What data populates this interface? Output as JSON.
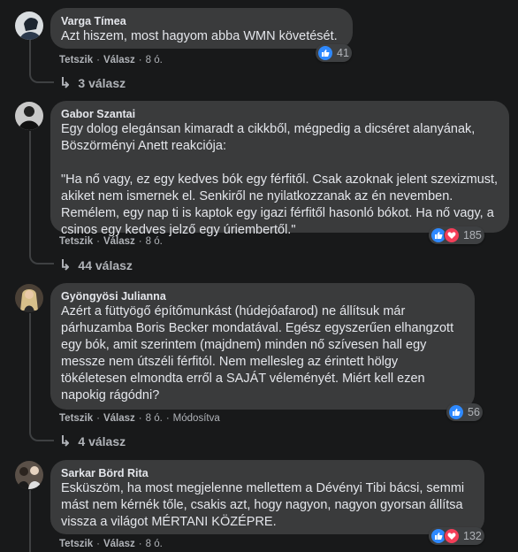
{
  "comments": [
    {
      "author": "Varga Tímea",
      "text": "Azt hiszem, most hagyom abba WMN követését.",
      "reaction_count": "41",
      "reactions": [
        "like-icon"
      ],
      "actions": {
        "like": "Tetszik",
        "reply": "Válasz",
        "time": "8 ó."
      },
      "replies": "3 válasz"
    },
    {
      "author": "Gabor Szantai",
      "text": "Egy dolog elegánsan kimaradt a cikkből, mégpedig a dicséret alanyának, Böszörményi Anett reakciója:\n\n\"Ha nő vagy, ez egy kedves bók egy férfitől. Csak azoknak jelent szexizmust, akiket nem ismernek el. Senkiről ne nyilatkozzanak az én nevemben. Remélem, egy nap ti is kaptok egy igazi férfitől hasonló bókot. Ha nő vagy, a csinos egy kedves jelző egy úriembertől.\"",
      "reaction_count": "185",
      "reactions": [
        "like-icon",
        "heart-icon"
      ],
      "actions": {
        "like": "Tetszik",
        "reply": "Válasz",
        "time": "8 ó."
      },
      "replies": "44 válasz"
    },
    {
      "author": "Gyöngyösi Julianna",
      "text": "Azért a füttyögő építőmunkást (húdejóafarod) ne állítsuk már párhuzamba Boris Becker mondatával. Egész egyszerűen elhangzott egy bók, amit szerintem (majdnem) minden nő szívesen hall egy messze nem útszéli férfitól. Nem mellesleg az érintett hölgy tökéletesen elmondta erről a SAJÁT véleményét. Miért kell ezen napokig rágódni?",
      "reaction_count": "56",
      "reactions": [
        "like-icon"
      ],
      "actions": {
        "like": "Tetszik",
        "reply": "Válasz",
        "time": "8 ó.",
        "edited": "Módosítva"
      },
      "replies": "4 válasz"
    },
    {
      "author": "Sarkar Börd Rita",
      "text": "Esküszöm, ha most megjelenne mellettem a Dévényi Tibi bácsi, semmi mást nem kérnék tőle, csakis azt, hogy nagyon, nagyon gyorsan állítsa vissza a világot MÉRTANI KÖZÉPRE.",
      "reaction_count": "132",
      "reactions": [
        "like-icon",
        "heart-icon"
      ],
      "actions": {
        "like": "Tetszik",
        "reply": "Válasz",
        "time": "8 ó."
      }
    }
  ],
  "colors": {
    "background": "#18191a",
    "bubble": "#3a3b3c",
    "like": "#2e89ff",
    "heart": "#f33e58",
    "secondary_text": "#b0b3b8"
  }
}
